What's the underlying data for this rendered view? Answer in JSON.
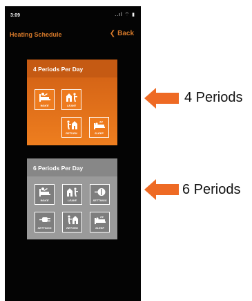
{
  "status_bar": {
    "time": "3:09",
    "icons": "..ıl ⌔ ▮"
  },
  "nav": {
    "title": "Heating Schedule",
    "back_label": "Back"
  },
  "cards": [
    {
      "title": "4 Periods Per Day",
      "tiles": [
        {
          "label": "WAKE",
          "icon": "wake-icon"
        },
        {
          "label": "LEAVE",
          "icon": "leave-icon"
        },
        {
          "label": "RETURN",
          "icon": "return-icon"
        },
        {
          "label": "SLEEP",
          "icon": "sleep-icon"
        }
      ]
    },
    {
      "title": "6 Periods Per Day",
      "tiles": [
        {
          "label": "WAKE",
          "icon": "wake-icon"
        },
        {
          "label": "LEAVE",
          "icon": "leave-icon"
        },
        {
          "label": "SETTINGS",
          "icon": "settings-icon"
        },
        {
          "label": "SETTINGS",
          "icon": "settings-plug-icon"
        },
        {
          "label": "RETURN",
          "icon": "return-icon"
        },
        {
          "label": "SLEEP",
          "icon": "sleep-icon"
        }
      ]
    }
  ],
  "callouts": [
    {
      "text": "4 Periods"
    },
    {
      "text": "6 Periods"
    }
  ],
  "colors": {
    "accent": "#d87a2a",
    "arrow": "#ee6a24"
  }
}
